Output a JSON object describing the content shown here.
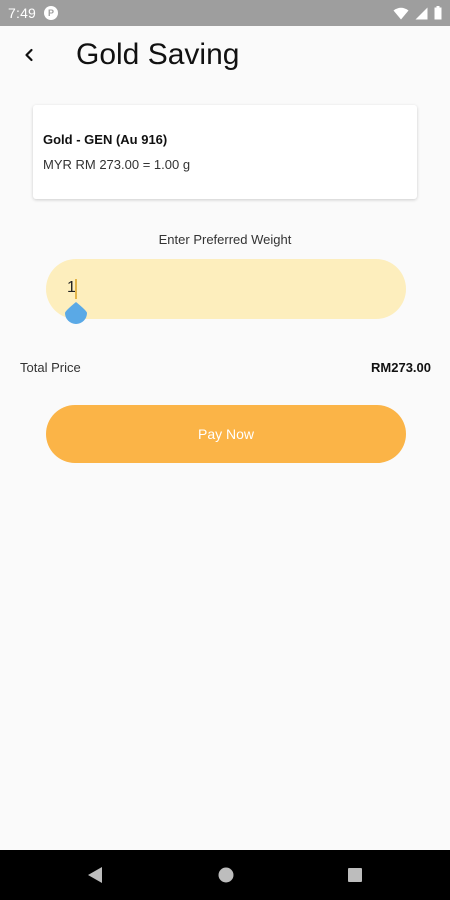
{
  "status_bar": {
    "time": "7:49",
    "app_icon_glyph": "P",
    "icons": [
      "wifi-icon",
      "signal-icon",
      "battery-icon"
    ]
  },
  "header": {
    "title": "Gold Saving",
    "back_icon": "chevron-left-icon"
  },
  "product": {
    "name": "Gold - GEN (Au 916)",
    "rate": "MYR RM 273.00 = 1.00 g"
  },
  "weight": {
    "label": "Enter Preferred Weight",
    "value": "1"
  },
  "total": {
    "label": "Total Price",
    "value": "RM273.00"
  },
  "actions": {
    "pay_label": "Pay Now"
  },
  "nav_bar": {
    "buttons": [
      "back-triangle-icon",
      "home-circle-icon",
      "recents-square-icon"
    ]
  },
  "colors": {
    "accent": "#fbb447",
    "input_background": "#fdeebd",
    "cursor_handle": "#5aa9e6",
    "status_bar": "#9e9e9e",
    "background": "#fafafa"
  }
}
